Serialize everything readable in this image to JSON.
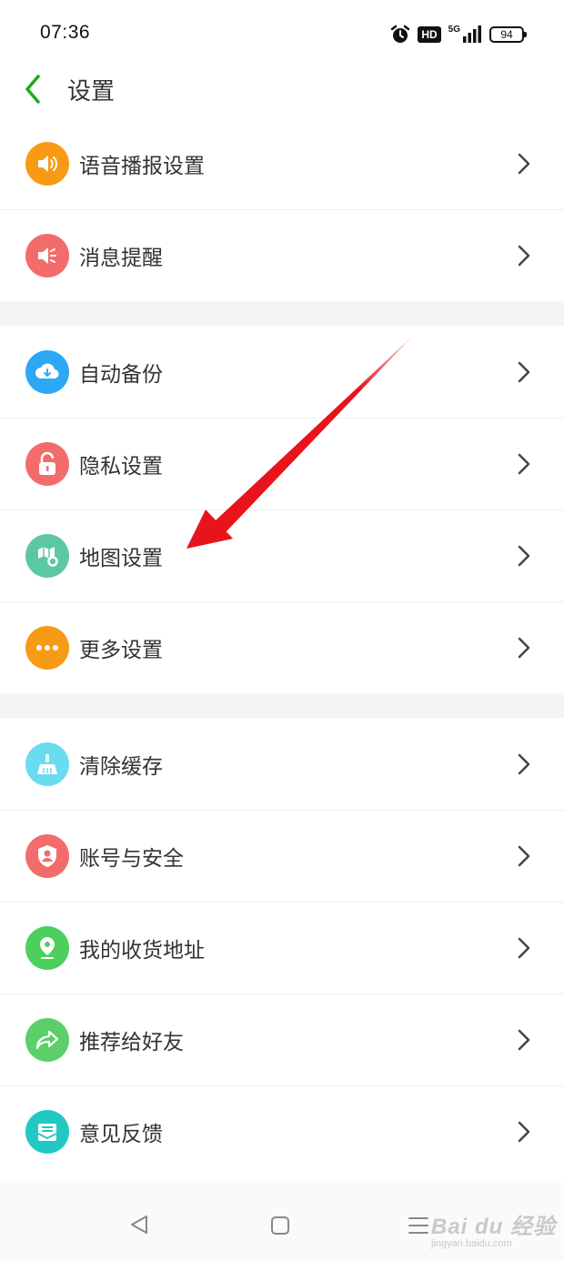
{
  "status_bar": {
    "time": "07:36",
    "hd": "HD",
    "network": "5G",
    "battery": "94"
  },
  "header": {
    "title": "设置"
  },
  "groups": [
    {
      "items": [
        {
          "label": "语音播报设置",
          "icon": "speaker-icon",
          "color": "#f79a16"
        },
        {
          "label": "消息提醒",
          "icon": "megaphone-icon",
          "color": "#f26c6c"
        }
      ]
    },
    {
      "items": [
        {
          "label": "自动备份",
          "icon": "cloud-download-icon",
          "color": "#2ea8f6"
        },
        {
          "label": "隐私设置",
          "icon": "lock-icon",
          "color": "#f26c6c"
        },
        {
          "label": "地图设置",
          "icon": "map-settings-icon",
          "color": "#5cc8a2"
        },
        {
          "label": "更多设置",
          "icon": "more-dots-icon",
          "color": "#f79a16"
        }
      ]
    },
    {
      "items": [
        {
          "label": "清除缓存",
          "icon": "broom-icon",
          "color": "#6adcf0"
        },
        {
          "label": "账号与安全",
          "icon": "shield-user-icon",
          "color": "#f26c6c"
        },
        {
          "label": "我的收货地址",
          "icon": "location-pin-icon",
          "color": "#4ccf5c"
        },
        {
          "label": "推荐给好友",
          "icon": "share-arrow-icon",
          "color": "#5bcf68"
        },
        {
          "label": "意见反馈",
          "icon": "feedback-mail-icon",
          "color": "#22c9c4"
        }
      ]
    }
  ],
  "colors": {
    "accent_green": "#1aad19",
    "annotation_red": "#e8141b"
  },
  "watermark": {
    "main": "Bai du 经验",
    "sub": "jingyan.baidu.com"
  }
}
